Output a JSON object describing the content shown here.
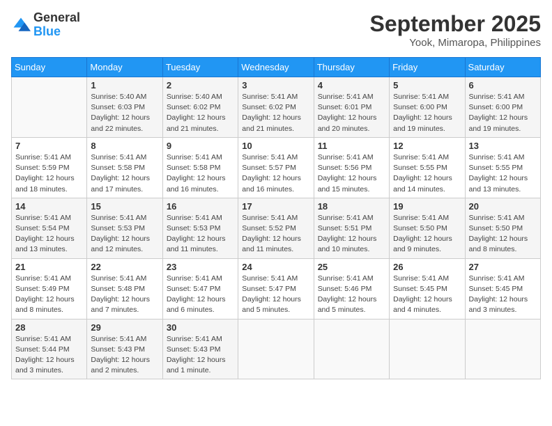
{
  "header": {
    "logo_general": "General",
    "logo_blue": "Blue",
    "month_title": "September 2025",
    "location": "Yook, Mimaropa, Philippines"
  },
  "days_of_week": [
    "Sunday",
    "Monday",
    "Tuesday",
    "Wednesday",
    "Thursday",
    "Friday",
    "Saturday"
  ],
  "weeks": [
    [
      {
        "day": "",
        "info": ""
      },
      {
        "day": "1",
        "info": "Sunrise: 5:40 AM\nSunset: 6:03 PM\nDaylight: 12 hours\nand 22 minutes."
      },
      {
        "day": "2",
        "info": "Sunrise: 5:40 AM\nSunset: 6:02 PM\nDaylight: 12 hours\nand 21 minutes."
      },
      {
        "day": "3",
        "info": "Sunrise: 5:41 AM\nSunset: 6:02 PM\nDaylight: 12 hours\nand 21 minutes."
      },
      {
        "day": "4",
        "info": "Sunrise: 5:41 AM\nSunset: 6:01 PM\nDaylight: 12 hours\nand 20 minutes."
      },
      {
        "day": "5",
        "info": "Sunrise: 5:41 AM\nSunset: 6:00 PM\nDaylight: 12 hours\nand 19 minutes."
      },
      {
        "day": "6",
        "info": "Sunrise: 5:41 AM\nSunset: 6:00 PM\nDaylight: 12 hours\nand 19 minutes."
      }
    ],
    [
      {
        "day": "7",
        "info": "Sunrise: 5:41 AM\nSunset: 5:59 PM\nDaylight: 12 hours\nand 18 minutes."
      },
      {
        "day": "8",
        "info": "Sunrise: 5:41 AM\nSunset: 5:58 PM\nDaylight: 12 hours\nand 17 minutes."
      },
      {
        "day": "9",
        "info": "Sunrise: 5:41 AM\nSunset: 5:58 PM\nDaylight: 12 hours\nand 16 minutes."
      },
      {
        "day": "10",
        "info": "Sunrise: 5:41 AM\nSunset: 5:57 PM\nDaylight: 12 hours\nand 16 minutes."
      },
      {
        "day": "11",
        "info": "Sunrise: 5:41 AM\nSunset: 5:56 PM\nDaylight: 12 hours\nand 15 minutes."
      },
      {
        "day": "12",
        "info": "Sunrise: 5:41 AM\nSunset: 5:55 PM\nDaylight: 12 hours\nand 14 minutes."
      },
      {
        "day": "13",
        "info": "Sunrise: 5:41 AM\nSunset: 5:55 PM\nDaylight: 12 hours\nand 13 minutes."
      }
    ],
    [
      {
        "day": "14",
        "info": "Sunrise: 5:41 AM\nSunset: 5:54 PM\nDaylight: 12 hours\nand 13 minutes."
      },
      {
        "day": "15",
        "info": "Sunrise: 5:41 AM\nSunset: 5:53 PM\nDaylight: 12 hours\nand 12 minutes."
      },
      {
        "day": "16",
        "info": "Sunrise: 5:41 AM\nSunset: 5:53 PM\nDaylight: 12 hours\nand 11 minutes."
      },
      {
        "day": "17",
        "info": "Sunrise: 5:41 AM\nSunset: 5:52 PM\nDaylight: 12 hours\nand 11 minutes."
      },
      {
        "day": "18",
        "info": "Sunrise: 5:41 AM\nSunset: 5:51 PM\nDaylight: 12 hours\nand 10 minutes."
      },
      {
        "day": "19",
        "info": "Sunrise: 5:41 AM\nSunset: 5:50 PM\nDaylight: 12 hours\nand 9 minutes."
      },
      {
        "day": "20",
        "info": "Sunrise: 5:41 AM\nSunset: 5:50 PM\nDaylight: 12 hours\nand 8 minutes."
      }
    ],
    [
      {
        "day": "21",
        "info": "Sunrise: 5:41 AM\nSunset: 5:49 PM\nDaylight: 12 hours\nand 8 minutes."
      },
      {
        "day": "22",
        "info": "Sunrise: 5:41 AM\nSunset: 5:48 PM\nDaylight: 12 hours\nand 7 minutes."
      },
      {
        "day": "23",
        "info": "Sunrise: 5:41 AM\nSunset: 5:47 PM\nDaylight: 12 hours\nand 6 minutes."
      },
      {
        "day": "24",
        "info": "Sunrise: 5:41 AM\nSunset: 5:47 PM\nDaylight: 12 hours\nand 5 minutes."
      },
      {
        "day": "25",
        "info": "Sunrise: 5:41 AM\nSunset: 5:46 PM\nDaylight: 12 hours\nand 5 minutes."
      },
      {
        "day": "26",
        "info": "Sunrise: 5:41 AM\nSunset: 5:45 PM\nDaylight: 12 hours\nand 4 minutes."
      },
      {
        "day": "27",
        "info": "Sunrise: 5:41 AM\nSunset: 5:45 PM\nDaylight: 12 hours\nand 3 minutes."
      }
    ],
    [
      {
        "day": "28",
        "info": "Sunrise: 5:41 AM\nSunset: 5:44 PM\nDaylight: 12 hours\nand 3 minutes."
      },
      {
        "day": "29",
        "info": "Sunrise: 5:41 AM\nSunset: 5:43 PM\nDaylight: 12 hours\nand 2 minutes."
      },
      {
        "day": "30",
        "info": "Sunrise: 5:41 AM\nSunset: 5:43 PM\nDaylight: 12 hours\nand 1 minute."
      },
      {
        "day": "",
        "info": ""
      },
      {
        "day": "",
        "info": ""
      },
      {
        "day": "",
        "info": ""
      },
      {
        "day": "",
        "info": ""
      }
    ]
  ]
}
